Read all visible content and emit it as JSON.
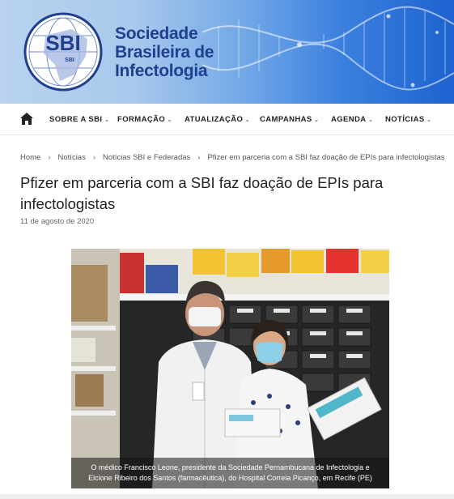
{
  "header": {
    "logo_mark_text": "SBI",
    "logo_sub_mark": "SBI",
    "org_name_line1": "Sociedade",
    "org_name_line2": "Brasileira de",
    "org_name_line3": "Infectologia"
  },
  "nav": {
    "home_icon": "home-icon",
    "items": [
      {
        "label": "SOBRE A SBI"
      },
      {
        "label": "FORMAÇÃO"
      },
      {
        "label": "ATUALIZAÇÃO"
      },
      {
        "label": "CAMPANHAS"
      },
      {
        "label": "AGENDA"
      },
      {
        "label": "NOTÍCIAS"
      }
    ],
    "chevron": "⌄"
  },
  "breadcrumb": {
    "items": [
      "Home",
      "Notícias",
      "Notícias SBI e Federadas",
      "Pfizer em parceria com a SBI faz doação de EPIs para infectologistas"
    ],
    "separator": "›"
  },
  "article": {
    "title": "Pfizer em parceria com a SBI faz doação de EPIs para infectologistas",
    "date": "11 de agosto de 2020",
    "caption_line1": "O médico Francisco Leone, presidente da Sociedade Pernambucana de Infectologia e",
    "caption_line2": "Elcione Ribeiro dos Santos (farmacêutica), do Hospital Correia Picanço, em Recife (PE)"
  },
  "colors": {
    "brand_blue": "#1f3f8f",
    "banner_blue": "#1d63cf"
  }
}
